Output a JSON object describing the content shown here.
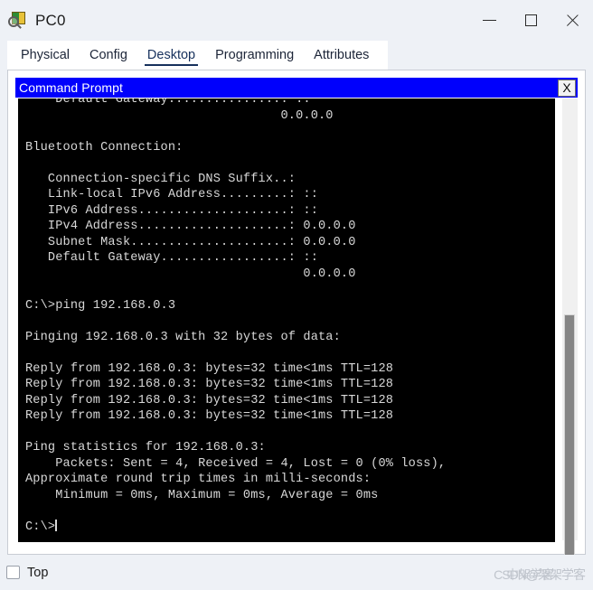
{
  "window": {
    "title": "PC0",
    "icon": "packet-tracer-pc-icon",
    "controls": {
      "minimize": "—",
      "maximize": "☐",
      "close": "✕"
    }
  },
  "tabs": [
    {
      "label": "Physical",
      "active": false
    },
    {
      "label": "Config",
      "active": false
    },
    {
      "label": "Desktop",
      "active": true
    },
    {
      "label": "Programming",
      "active": false
    },
    {
      "label": "Attributes",
      "active": false
    }
  ],
  "command_prompt": {
    "title": "Command Prompt",
    "close_label": "X",
    "terminal_text": "    Default Gateway...............: ::\n                                  0.0.0.0\n\nBluetooth Connection:\n\n   Connection-specific DNS Suffix..:\n   Link-local IPv6 Address.........: ::\n   IPv6 Address....................: ::\n   IPv4 Address....................: 0.0.0.0\n   Subnet Mask.....................: 0.0.0.0\n   Default Gateway.................: ::\n                                     0.0.0.0\n\nC:\\>ping 192.168.0.3\n\nPinging 192.168.0.3 with 32 bytes of data:\n\nReply from 192.168.0.3: bytes=32 time<1ms TTL=128\nReply from 192.168.0.3: bytes=32 time<1ms TTL=128\nReply from 192.168.0.3: bytes=32 time<1ms TTL=128\nReply from 192.168.0.3: bytes=32 time<1ms TTL=128\n\nPing statistics for 192.168.0.3:\n    Packets: Sent = 4, Received = 4, Lost = 0 (0% loss),\nApproximate round trip times in milli-seconds:\n    Minimum = 0ms, Maximum = 0ms, Average = 0ms\n\nC:\\>",
    "prompt_tail": "",
    "colors": {
      "title_bar": "#0000fc",
      "screen_bg": "#000000",
      "screen_fg": "#d8d8d8"
    }
  },
  "bottom": {
    "top_checkbox_label": "Top",
    "top_checkbox_checked": false,
    "watermark_primary": "CSDN",
    "watermark_secondary": "@架架学客",
    "watermark_overlap": "中架学客"
  }
}
